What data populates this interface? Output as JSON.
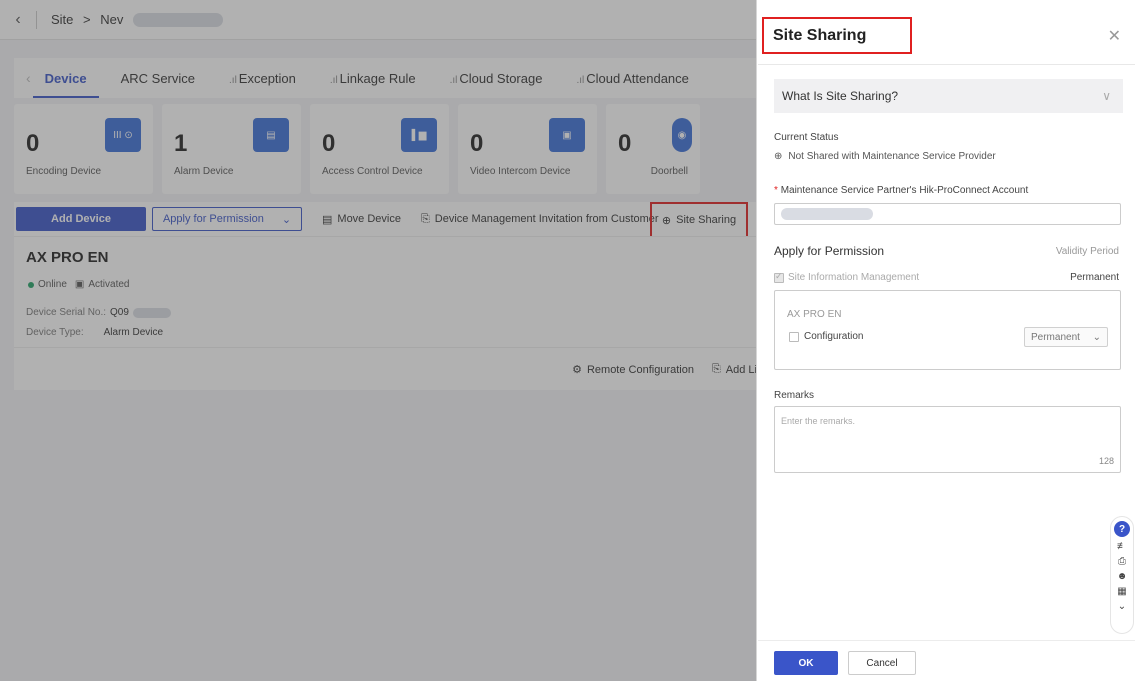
{
  "breadcrumb": {
    "back_icon": "chevron-left-icon",
    "root": "Site",
    "separator": ">",
    "current": "Nev"
  },
  "tabs": [
    {
      "label": "Device",
      "active": true,
      "icon": ""
    },
    {
      "label": "ARC Service",
      "active": false,
      "icon": ""
    },
    {
      "label": "Exception",
      "active": false,
      "icon": "signal-icon"
    },
    {
      "label": "Linkage Rule",
      "active": false,
      "icon": "signal-icon"
    },
    {
      "label": "Cloud Storage",
      "active": false,
      "icon": "signal-icon"
    },
    {
      "label": "Cloud Attendance",
      "active": false,
      "icon": "signal-icon"
    }
  ],
  "cards": [
    {
      "count": "0",
      "label": "Encoding Device",
      "icon": "nvr-icon"
    },
    {
      "count": "1",
      "label": "Alarm Device",
      "icon": "alarm-panel-icon"
    },
    {
      "count": "0",
      "label": "Access Control Device",
      "icon": "access-control-icon"
    },
    {
      "count": "0",
      "label": "Video Intercom Device",
      "icon": "intercom-icon"
    },
    {
      "count": "0",
      "label": "Doorbell",
      "icon": "doorbell-icon"
    }
  ],
  "actions": {
    "add_device": "Add Device",
    "apply_permission": "Apply for Permission",
    "move_device": "Move Device",
    "invitation": "Device Management Invitation from Customer",
    "site_sharing": "Site Sharing"
  },
  "device": {
    "name": "AX PRO EN",
    "online": "Online",
    "activated": "Activated",
    "serial_label": "Device Serial No.:",
    "serial_value": "Q09",
    "type_label": "Device Type:",
    "type_value": "Alarm Device",
    "remote_config": "Remote Configuration",
    "add_linkage": "Add Li"
  },
  "drawer": {
    "title": "Site Sharing",
    "close_icon": "close-icon",
    "what_is": "What Is Site Sharing?",
    "current_status_label": "Current Status",
    "current_status_value": "Not Shared with Maintenance Service Provider",
    "account_label": "Maintenance Service Partner's Hik-ProConnect Account",
    "account_required": "*",
    "apply_permission": "Apply for Permission",
    "validity_period": "Validity Period",
    "site_info": "Site Information Management",
    "site_info_period": "Permanent",
    "device_name": "AX PRO EN",
    "configuration": "Configuration",
    "configuration_period": "Permanent",
    "remarks_label": "Remarks",
    "remarks_placeholder": "Enter the remarks.",
    "remarks_count": "128",
    "ok": "OK",
    "cancel": "Cancel"
  },
  "colors": {
    "accent": "#3a55c9",
    "highlight": "#e02020",
    "online": "#21a366"
  }
}
